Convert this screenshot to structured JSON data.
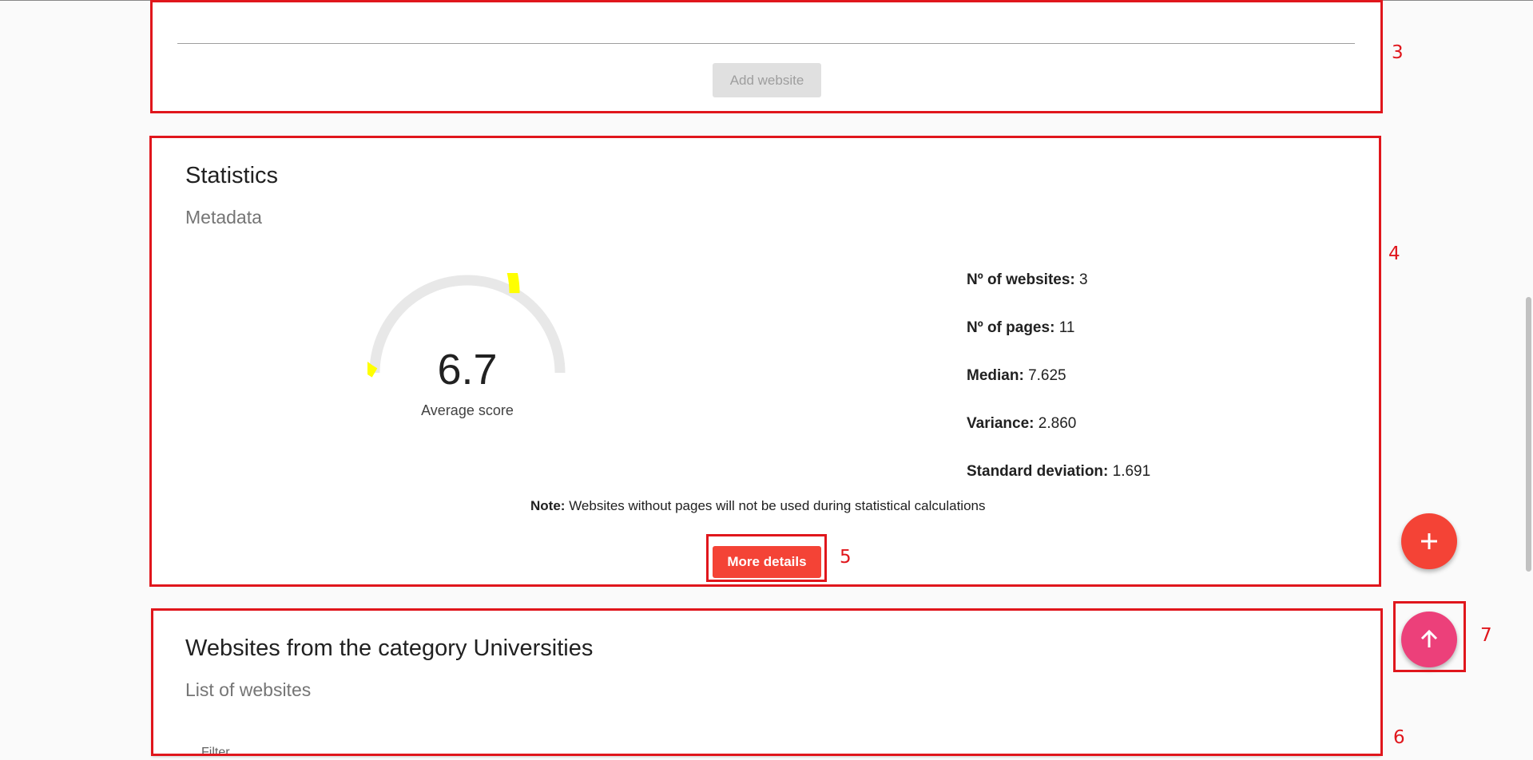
{
  "add_card": {
    "button_label": "Add website"
  },
  "statistics": {
    "title": "Statistics",
    "subtitle": "Metadata",
    "gauge": {
      "value": "6.7",
      "score": 6.7,
      "max": 10,
      "caption": "Average score",
      "fill_color": "#ffff00",
      "track_color": "#e8e8e8"
    },
    "stats": [
      {
        "label": "Nº of websites:",
        "value": "3"
      },
      {
        "label": "Nº of pages:",
        "value": "11"
      },
      {
        "label": "Median:",
        "value": "7.625"
      },
      {
        "label": "Variance:",
        "value": "2.860"
      },
      {
        "label": "Standard deviation:",
        "value": "1.691"
      }
    ],
    "note": {
      "label": "Note:",
      "text": "Websites without pages will not be used during statistical calculations"
    },
    "more_details_label": "More details"
  },
  "websites_card": {
    "title": "Websites from the category Universities",
    "subtitle": "List of websites",
    "filter_label": "Filter"
  },
  "fabs": {
    "add_icon": "plus-icon",
    "up_icon": "arrow-up-icon",
    "add_color": "#f44336",
    "up_color": "#ec407a"
  },
  "annotations": [
    "3",
    "4",
    "5",
    "6",
    "7"
  ],
  "colors": {
    "annotation_red": "#e0161c",
    "accent_red": "#f44336"
  }
}
